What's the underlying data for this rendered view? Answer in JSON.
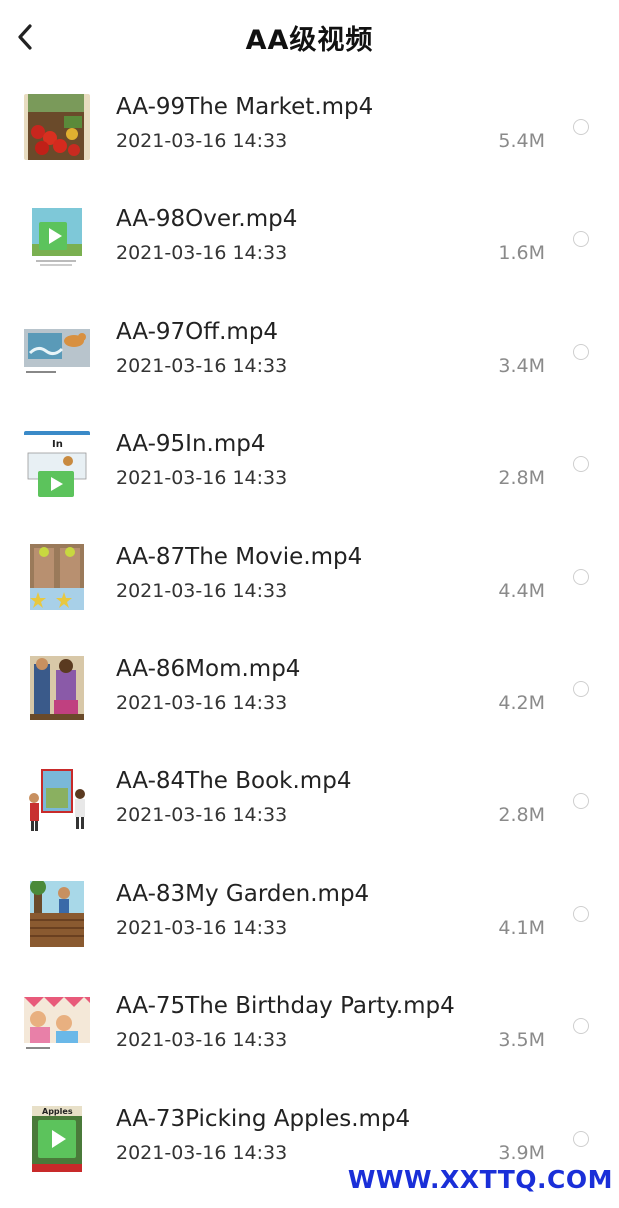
{
  "header": {
    "title": "AA级视频"
  },
  "items": [
    {
      "name": "AA-99The Market.mp4",
      "date": "2021-03-16 14:33",
      "size": "5.4M",
      "thumb": "market"
    },
    {
      "name": "AA-98Over.mp4",
      "date": "2021-03-16 14:33",
      "size": "1.6M",
      "thumb": "over"
    },
    {
      "name": "AA-97Off.mp4",
      "date": "2021-03-16 14:33",
      "size": "3.4M",
      "thumb": "off"
    },
    {
      "name": "AA-95In.mp4",
      "date": "2021-03-16 14:33",
      "size": "2.8M",
      "thumb": "in"
    },
    {
      "name": "AA-87The Movie.mp4",
      "date": "2021-03-16 14:33",
      "size": "4.4M",
      "thumb": "movie"
    },
    {
      "name": "AA-86Mom.mp4",
      "date": "2021-03-16 14:33",
      "size": "4.2M",
      "thumb": "mom"
    },
    {
      "name": "AA-84The Book.mp4",
      "date": "2021-03-16 14:33",
      "size": "2.8M",
      "thumb": "book"
    },
    {
      "name": "AA-83My Garden.mp4",
      "date": "2021-03-16 14:33",
      "size": "4.1M",
      "thumb": "garden"
    },
    {
      "name": "AA-75The Birthday Party.mp4",
      "date": "2021-03-16 14:33",
      "size": "3.5M",
      "thumb": "birthday"
    },
    {
      "name": "AA-73Picking Apples.mp4",
      "date": "2021-03-16 14:33",
      "size": "3.9M",
      "thumb": "apples"
    }
  ],
  "watermark": "WWW.XXTTQ.COM",
  "colors": {
    "play_button": "#5cc35c",
    "watermark": "#1a2fd8"
  }
}
